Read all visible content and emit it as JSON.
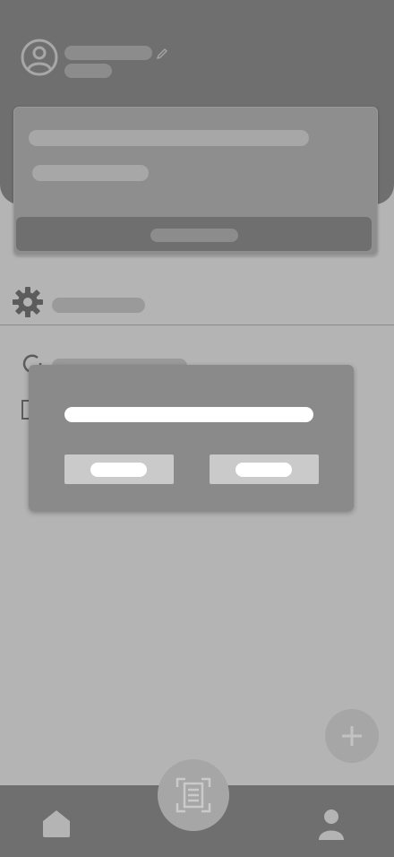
{
  "icons": {
    "avatar": "user-circle-icon",
    "edit": "pencil-icon",
    "settings": "gear-icon",
    "row2": "refresh-icon",
    "row3": "document-icon",
    "add": "plus-icon",
    "home": "home-icon",
    "scan": "scan-document-icon",
    "profile": "person-icon"
  },
  "colors": {
    "background": "#b5b4b5",
    "header": "#706f70",
    "card": "#8f8e8f",
    "modal": "#8b8a8b",
    "modal_button": "#cbcacb"
  }
}
